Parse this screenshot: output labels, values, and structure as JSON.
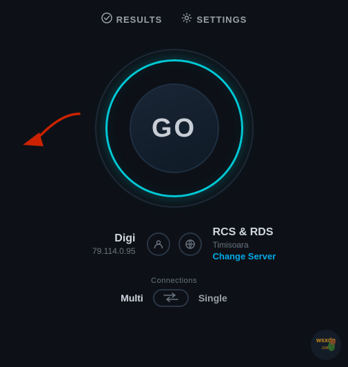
{
  "nav": {
    "results_icon": "✓",
    "results_label": "RESULTS",
    "settings_icon": "⚙",
    "settings_label": "SETTINGS"
  },
  "go_button": {
    "label": "GO"
  },
  "client": {
    "name": "Digi",
    "ip": "79.114.0.95"
  },
  "server": {
    "name": "RCS & RDS",
    "city": "Timisoara",
    "change_label": "Change Server"
  },
  "connections": {
    "label": "Connections",
    "multi_label": "Multi",
    "single_label": "Single"
  }
}
